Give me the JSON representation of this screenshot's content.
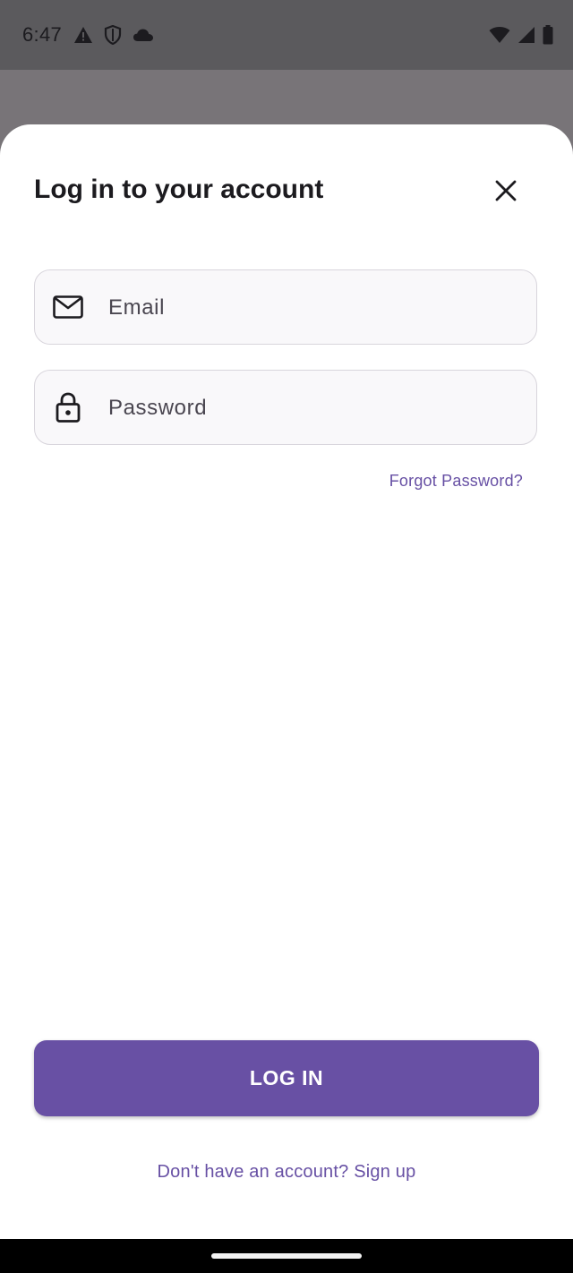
{
  "status_bar": {
    "time": "6:47",
    "left_icons": [
      "warning-icon",
      "shield-icon",
      "cloud-icon"
    ],
    "right_icons": [
      "wifi-icon",
      "signal-icon",
      "battery-icon"
    ]
  },
  "sheet": {
    "title": "Log in to your account",
    "close_icon": "close-icon"
  },
  "email_field": {
    "icon": "mail-icon",
    "placeholder": "Email",
    "value": ""
  },
  "password_field": {
    "icon": "lock-icon",
    "placeholder": "Password",
    "value": ""
  },
  "forgot_password": "Forgot Password?",
  "login_button": "LOG IN",
  "signup_link": "Don't have an account? Sign up",
  "colors": {
    "accent": "#6850a4",
    "link": "#6750a4",
    "scrim": "#787478",
    "status_bar": "#5b5a5d"
  }
}
